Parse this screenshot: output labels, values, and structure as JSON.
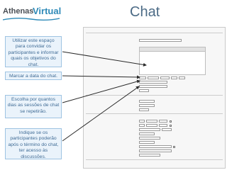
{
  "logo": {
    "part1": "Athenas",
    "part2": "Virtual"
  },
  "title": "Chat",
  "callouts": [
    "Utilizar este espaço para convidar os participantes e informar quais os objetivos do chat.",
    "Marcar a data do chat.",
    "Escolha por quantos dias as sessões de chat se repetirão.",
    "Indique se os participantes poderão após o término do chat, ter acesso às discussões."
  ],
  "colors": {
    "callout_bg": "#eaf3fb",
    "callout_border": "#9ec3e2",
    "callout_text": "#3f6b95",
    "title": "#4c6b86",
    "arrow": "#2a2a2a"
  },
  "icons": [
    "logo-swoosh-icon",
    "arrow-icon"
  ]
}
